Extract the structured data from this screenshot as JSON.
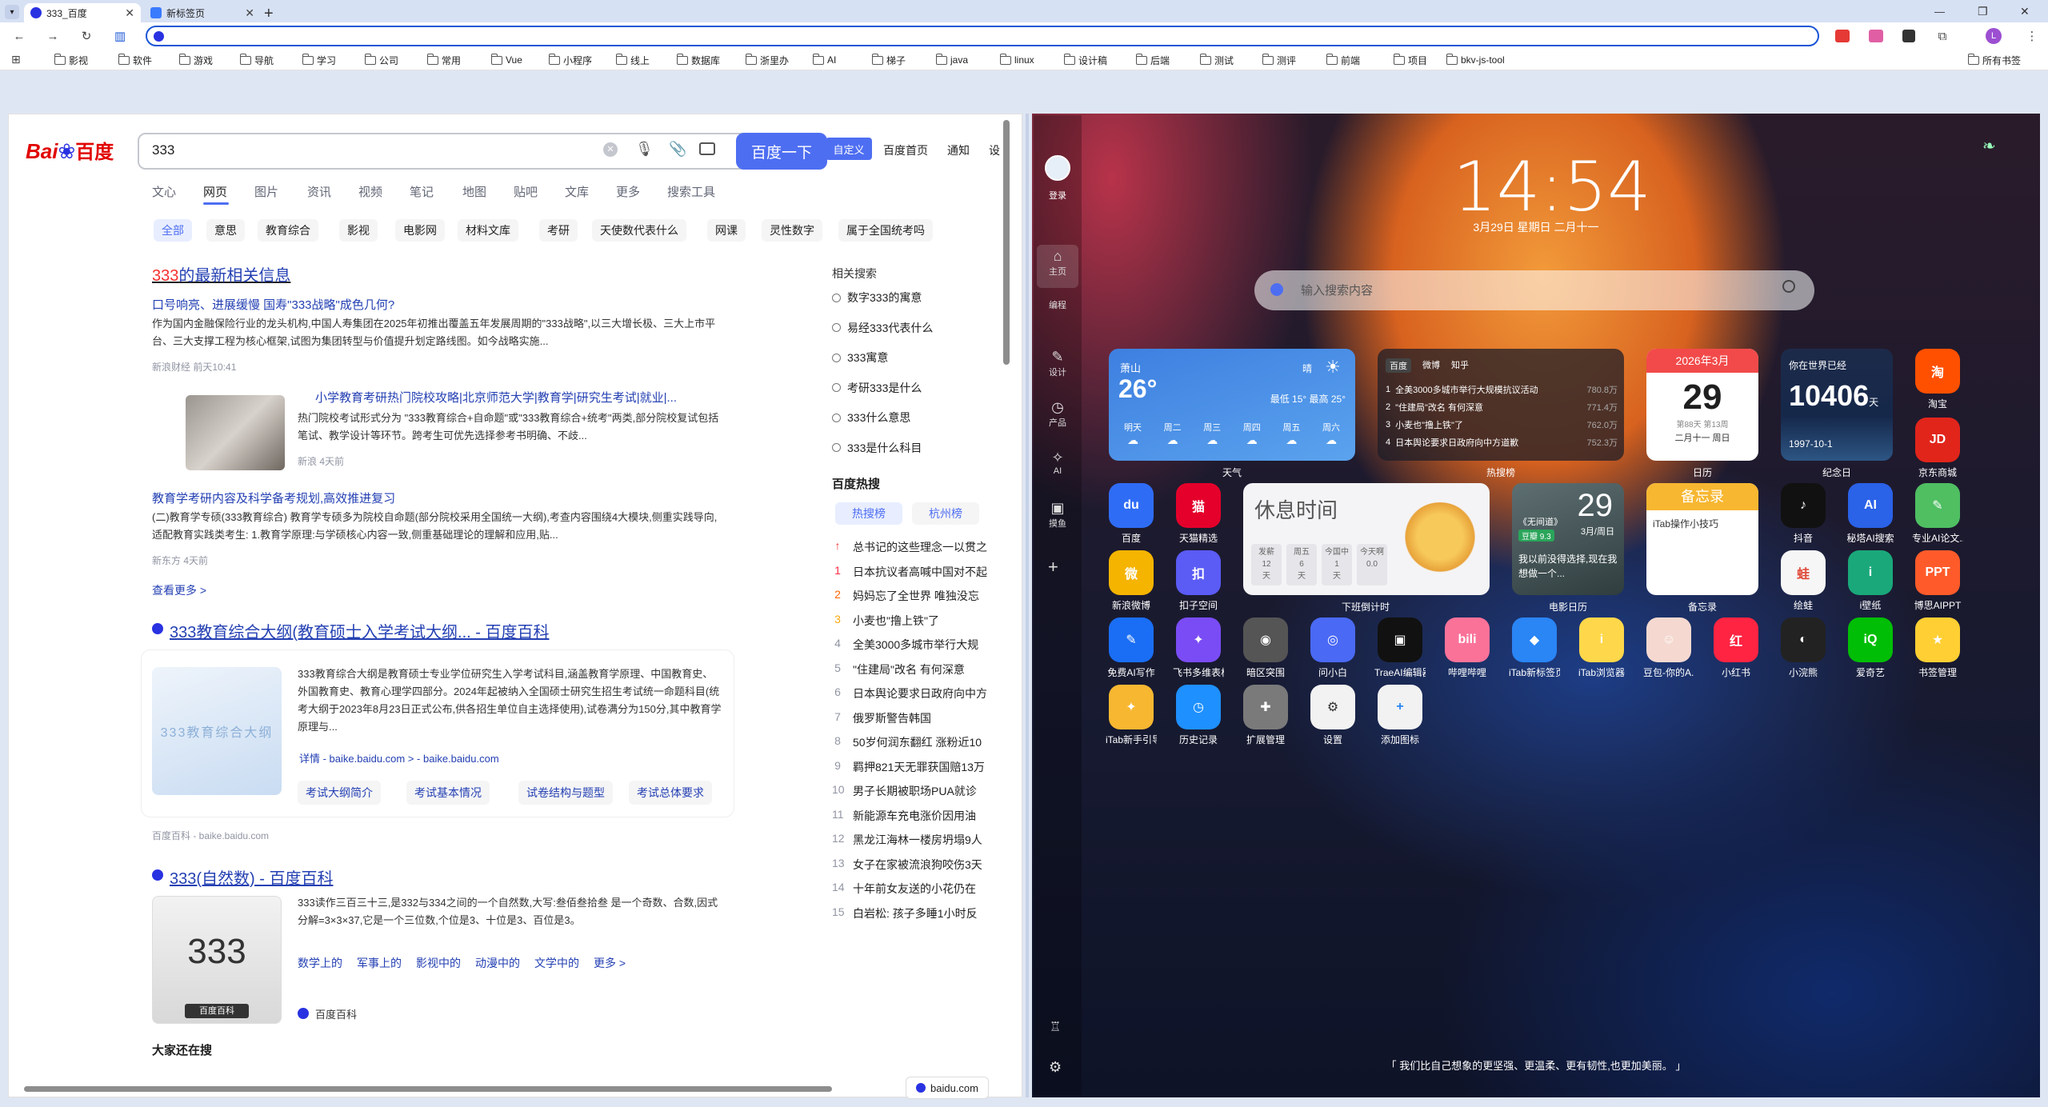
{
  "browser": {
    "tabs": [
      {
        "title": "333_百度",
        "active": true
      },
      {
        "title": "新标签页",
        "active": false
      }
    ],
    "new_tab": "+",
    "window_controls": [
      "—",
      "❐",
      "✕"
    ],
    "bookmarks": [
      "影视",
      "软件",
      "游戏",
      "导航",
      "学习",
      "公司",
      "常用",
      "Vue",
      "小程序",
      "线上",
      "数据库",
      "浙里办",
      "AI",
      "梯子",
      "java",
      "linux",
      "设计稿",
      "后端",
      "测试",
      "测评",
      "前端",
      "项目",
      "bkv-js-tool"
    ],
    "all_bookmarks": "所有书签",
    "accent": "#1a56d6",
    "profile_initial": "L"
  },
  "baidu": {
    "logo_text": "Bai",
    "logo_text2": "百度",
    "query": "333",
    "search_button": "百度一下",
    "custom_btn": "自定义",
    "top_links": [
      "百度首页",
      "通知",
      "设"
    ],
    "nav": [
      "文心",
      "网页",
      "图片",
      "资讯",
      "视频",
      "笔记",
      "地图",
      "贴吧",
      "文库",
      "更多",
      "搜索工具"
    ],
    "chips": [
      "全部",
      "意思",
      "教育综合",
      "影视",
      "电影网",
      "材料文库",
      "考研",
      "天使数代表什么",
      "网课",
      "灵性数字",
      "属于全国统考吗"
    ],
    "news_title_red": "333",
    "news_title_rest": "的最新相关信息",
    "n1_title": "口号响亮、进展缓慢 国寿\"333战略\"成色几何?",
    "n1_body": "作为国内金融保险行业的龙头机构,中国人寿集团在2025年初推出覆盖五年发展周期的\"333战略\",以三大增长极、三大上市平台、三大支撑工程为核心框架,试图为集团转型与价值提升划定路线图。如今战略实施...",
    "n1_meta": "新浪财经   前天10:41",
    "n2_title": "小学教育考研热门院校攻略|北京师范大学|教育学|研究生考试|就业|...",
    "n2_body": "热门院校考试形式分为 \"333教育综合+自命题\"或\"333教育综合+统考\"两类,部分院校复试包括笔试、教学设计等环节。跨考生可优先选择参考书明确、不歧...",
    "n2_meta": "新浪   4天前",
    "n3_title": "教育学考研内容及科学备考规划,高效推进复习",
    "n3_body": "(二)教育学专硕(333教育综合) 教育学专硕多为院校自命题(部分院校采用全国统一大纲),考查内容围绕4大模块,侧重实践导向,适配教育实践类考生: 1.教育学原理:与学硕核心内容一致,侧重基础理论的理解和应用,贴...",
    "n3_meta": "新东方   4天前",
    "see_more": "查看更多 >",
    "r2_title": "333教育综合大纲(教育硕士入学考试大纲... - 百度百科",
    "r2_thumb": "333教育综合大纲",
    "r2_body": "333教育综合大纲是教育硕士专业学位研究生入学考试科目,涵盖教育学原理、中国教育史、外国教育史、教育心理学四部分。2024年起被纳入全国硕士研究生招生考试统一命题科目(统考大纲于2023年8月23日正式公布,供各招生单位自主选择使用),试卷满分为150分,其中教育学原理与...",
    "r2_links": "详情 - baike.baidu.com >  - baike.baidu.com",
    "r2_btns": [
      "考试大纲简介",
      "考试基本情况",
      "试卷结构与题型",
      "考试总体要求"
    ],
    "r2_source": "百度百科 - baike.baidu.com",
    "r3_title": "333(自然数) - 百度百科",
    "r3_thumb": "333",
    "r3_thumb_sub": "百度百科",
    "r3_body": "333读作三百三十三,是332与334之间的一个自然数,大写:叁佰叁拾叁 是一个奇数、合数,因式分解=3×3×37,它是一个三位数,个位是3、十位是3、百位是3。",
    "r3_links": [
      "数学上的",
      "军事上的",
      "影视中的",
      "动漫中的",
      "文学中的",
      "更多 >"
    ],
    "r3_source": "百度百科",
    "also_search": "大家还在搜",
    "related_title": "相关搜索",
    "related": [
      "数字333的寓意",
      "易经333代表什么",
      "333寓意",
      "考研333是什么",
      "333什么意思",
      "333是什么科目"
    ],
    "hot_title": "百度热搜",
    "hot_tabs": [
      "热搜榜",
      "杭州榜"
    ],
    "hot_items": [
      [
        "↑",
        "总书记的这些理念一以贯之"
      ],
      [
        "1",
        "日本抗议者高喊中国对不起"
      ],
      [
        "2",
        "妈妈忘了全世界 唯独没忘"
      ],
      [
        "3",
        "小麦也\"撸上铁\"了"
      ],
      [
        "4",
        "全美3000多城市举行大规"
      ],
      [
        "5",
        "\"住建局\"改名 有何深意"
      ],
      [
        "6",
        "日本舆论要求日政府向中方"
      ],
      [
        "7",
        "俄罗斯警告韩国"
      ],
      [
        "8",
        "50岁何润东翻红 涨粉近10"
      ],
      [
        "9",
        "羁押821天无罪获国赔13万"
      ],
      [
        "10",
        "男子长期被职场PUA就诊"
      ],
      [
        "11",
        "新能源车充电涨价因用油"
      ],
      [
        "12",
        "黑龙江海林一楼房坍塌9人"
      ],
      [
        "13",
        "女子在家被流浪狗咬伤3天"
      ],
      [
        "14",
        "十年前女友送的小花仍在"
      ],
      [
        "15",
        "白岩松: 孩子多睡1小时反"
      ]
    ],
    "status_url": "baidu.com"
  },
  "itab": {
    "login": "登录",
    "side_nav": [
      "主页",
      "编程",
      "设计",
      "产品",
      "AI",
      "摸鱼"
    ],
    "clock": "14:54",
    "date": "3月29日  星期日  二月十一",
    "search_placeholder": "输入搜索内容",
    "weather": {
      "city": "萧山",
      "temp": "26°",
      "cond": "晴",
      "range": "最低 15°  最高 25°",
      "days": [
        "明天",
        "周二",
        "周三",
        "周四",
        "周五",
        "周六"
      ],
      "label": "天气"
    },
    "hotlist": {
      "tabs": [
        "百度",
        "微博",
        "知乎"
      ],
      "items": [
        [
          "1",
          "全美3000多城市举行大规模抗议活动",
          "780.8万"
        ],
        [
          "2",
          "\"住建局\"改名 有何深意",
          "771.4万"
        ],
        [
          "3",
          "小麦也\"撸上铁\"了",
          "762.0万"
        ],
        [
          "4",
          "日本舆论要求日政府向中方道歉",
          "752.3万"
        ]
      ],
      "label": "热搜榜"
    },
    "calendar": {
      "month": "2026年3月",
      "day": "29",
      "week": "第88天 第13周",
      "lunar": "二月十一 周日",
      "label": "日历"
    },
    "anniv": {
      "title": "你在世界已经",
      "days": "10406",
      "unit": "天",
      "date": "1997-10-1",
      "label": "纪念日"
    },
    "rest": {
      "title": "休息时间",
      "cells": [
        [
          "发薪",
          "12",
          "天"
        ],
        [
          "周五",
          "6",
          "天"
        ],
        [
          "今国中",
          "1",
          "天"
        ],
        [
          "今天啊",
          "0.0",
          ""
        ]
      ],
      "label": "下班倒计时"
    },
    "movie": {
      "day": "29",
      "date": "3月/周日",
      "title": "《无间道》",
      "score": "豆瓣 9.3",
      "quote": "我以前没得选择,现在我想做一个...",
      "label": "电影日历"
    },
    "memo": {
      "title": "备忘录",
      "text": "iTab操作小技巧",
      "label": "备忘录"
    },
    "apps_row1": [
      "淘宝",
      "京东商城"
    ],
    "apps_a": [
      "百度",
      "天猫精选"
    ],
    "apps_b": [
      "新浪微博",
      "扣子空间"
    ],
    "apps_c": [
      "抖音",
      "秘塔AI搜索",
      "专业AI论文..."
    ],
    "apps_d": [
      "绘蛙",
      "i壁纸",
      "博思AIPPT"
    ],
    "apps_row3": [
      "免费AI写作",
      "飞书多维表格",
      "暗区突围",
      "问小白",
      "TraeAI编辑器",
      "哔哩哔哩",
      "iTab新标签页",
      "iTab浏览器",
      "豆包-你的A...",
      "小红书",
      "小浣熊",
      "爱奇艺",
      "书签管理"
    ],
    "apps_row4": [
      "iTab新手引导",
      "历史记录",
      "扩展管理",
      "设置",
      "添加图标"
    ],
    "quote": "「 我们比自己想象的更坚强、更温柔、更有韧性,也更加美丽。 」"
  }
}
